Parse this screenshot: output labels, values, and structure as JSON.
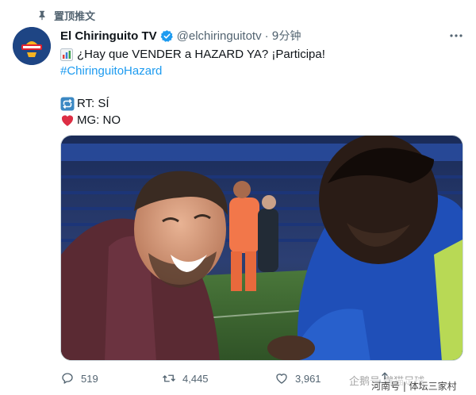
{
  "pinned": {
    "label": "置顶推文",
    "icon": "pin-icon"
  },
  "author": {
    "display_name": "El Chiringuito TV",
    "handle": "@elchiringuitotv",
    "separator": "·",
    "time": "9分钟",
    "verified_icon": "verified-badge-icon",
    "avatar_icon": "chiringuito-logo"
  },
  "tweet": {
    "line1": "¿Hay que VENDER a HAZARD YA? ¡Participa!",
    "hashtag": "#ChiringuitoHazard",
    "option_rt": "RT: SÍ",
    "option_mg": "MG: NO"
  },
  "actions": {
    "reply_count": "519",
    "retweet_count": "4,445",
    "like_count": "3,961"
  },
  "watermark": {
    "text": "企鹅号 懒猫足球",
    "text2": "河南号 | 体坛三家村"
  },
  "colors": {
    "link": "#1d9bf0",
    "secondary": "#536471",
    "like": "#e0245e"
  }
}
